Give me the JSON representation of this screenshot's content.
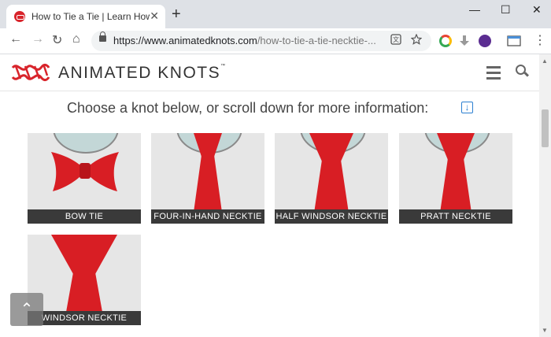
{
  "browser": {
    "tab_title": "How to Tie a Tie | Learn How to",
    "tab_close": "✕",
    "new_tab": "+",
    "window_controls": [
      "—",
      "☐",
      "✕"
    ],
    "url_host": "https://www.animatedknots.com",
    "url_path": "/how-to-tie-a-tie-necktie-...",
    "nav": {
      "back": "←",
      "forward": "→",
      "reload": "↻",
      "home": "⌂"
    },
    "menu": "⋮"
  },
  "site": {
    "brand": "ANIMATED KNOTS",
    "brand_tm": "™",
    "headline": "Choose a knot below, or scroll down for more information:",
    "scroll_down_icon": "↓",
    "scroll_top_icon": "⌃",
    "accent_color": "#d8242b",
    "knots": [
      {
        "label": "BOW TIE"
      },
      {
        "label": "FOUR-IN-HAND NECKTIE"
      },
      {
        "label": "HALF WINDSOR NECKTIE"
      },
      {
        "label": "PRATT NECKTIE"
      },
      {
        "label": "WINDSOR NECKTIE"
      }
    ]
  }
}
